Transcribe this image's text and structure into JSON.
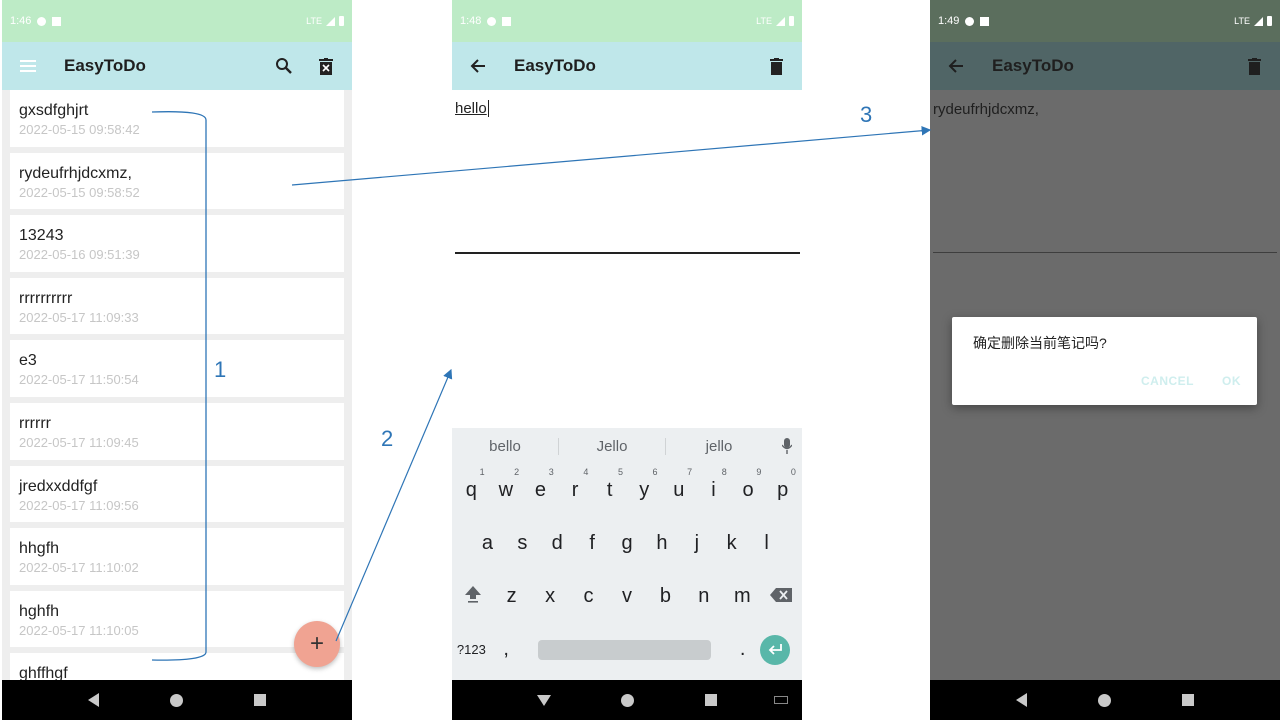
{
  "phone1": {
    "status": {
      "time": "1:46",
      "network": "LTE"
    },
    "app_bar": {
      "title": "EasyToDo"
    },
    "notes": [
      {
        "title": "gxsdfghjrt",
        "date": "2022-05-15 09:58:42"
      },
      {
        "title": "rydeufrhjdcxmz,",
        "date": "2022-05-15 09:58:52"
      },
      {
        "title": "13243",
        "date": "2022-05-16 09:51:39"
      },
      {
        "title": "rrrrrrrrrr",
        "date": "2022-05-17 11:09:33"
      },
      {
        "title": "e3",
        "date": "2022-05-17 11:50:54"
      },
      {
        "title": "rrrrrr",
        "date": "2022-05-17 11:09:45"
      },
      {
        "title": "jredxxddfgf",
        "date": "2022-05-17 11:09:56"
      },
      {
        "title": "hhgfh",
        "date": "2022-05-17 11:10:02"
      },
      {
        "title": "hghfh",
        "date": "2022-05-17 11:10:05"
      },
      {
        "title": "ghffhgf",
        "date": ""
      }
    ],
    "fab_label": "+"
  },
  "phone2": {
    "status": {
      "time": "1:48",
      "network": "LTE"
    },
    "app_bar": {
      "title": "EasyToDo"
    },
    "editor_text": "hello",
    "keyboard": {
      "suggestions": [
        "bello",
        "Jello",
        "jello"
      ],
      "row1": [
        {
          "k": "q",
          "n": "1"
        },
        {
          "k": "w",
          "n": "2"
        },
        {
          "k": "e",
          "n": "3"
        },
        {
          "k": "r",
          "n": "4"
        },
        {
          "k": "t",
          "n": "5"
        },
        {
          "k": "y",
          "n": "6"
        },
        {
          "k": "u",
          "n": "7"
        },
        {
          "k": "i",
          "n": "8"
        },
        {
          "k": "o",
          "n": "9"
        },
        {
          "k": "p",
          "n": "0"
        }
      ],
      "row2": [
        "a",
        "s",
        "d",
        "f",
        "g",
        "h",
        "j",
        "k",
        "l"
      ],
      "row3": [
        "z",
        "x",
        "c",
        "v",
        "b",
        "n",
        "m"
      ],
      "sym_label": "?123",
      "comma": ",",
      "period": "."
    }
  },
  "phone3": {
    "status": {
      "time": "1:49",
      "network": "LTE"
    },
    "app_bar": {
      "title": "EasyToDo"
    },
    "note_text": "rydeufrhjdcxmz,",
    "dialog": {
      "message": "确定删除当前笔记吗?",
      "cancel": "CANCEL",
      "ok": "OK"
    }
  },
  "annotations": {
    "step1": "1",
    "step2": "2",
    "step3": "3"
  },
  "colors": {
    "status_bar": "#bdebc6",
    "app_bar": "#bfe7ea",
    "fab": "#f0a392",
    "annotation": "#2e75b6",
    "dim_overlay": "#6b6b6b",
    "enter_key": "#59b7a9"
  }
}
